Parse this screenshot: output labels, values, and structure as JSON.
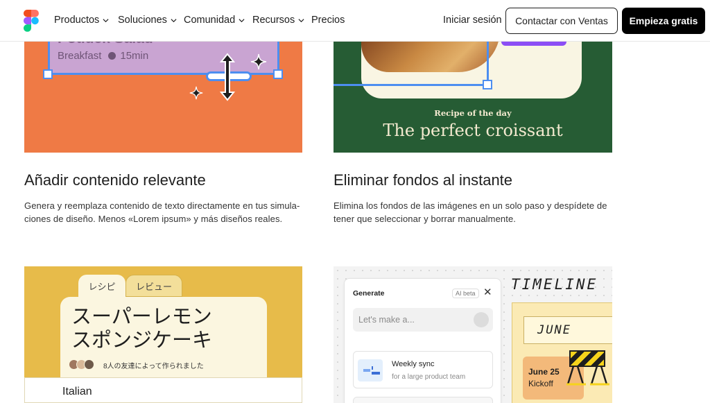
{
  "nav": {
    "items": [
      {
        "label": "Productos",
        "has_dropdown": true
      },
      {
        "label": "Soluciones",
        "has_dropdown": true
      },
      {
        "label": "Comunidad",
        "has_dropdown": true
      },
      {
        "label": "Recursos",
        "has_dropdown": true
      },
      {
        "label": "Precios",
        "has_dropdown": false
      }
    ],
    "login": "Iniciar sesión",
    "contact": "Contactar con Ventas",
    "start": "Empieza gratis"
  },
  "cards": [
    {
      "title": "Añadir contenido relevante",
      "desc_line1": "Genera y reemplaza contenido de texto directamente en tus simula-",
      "desc_line2": "ciones de diseño. Menos «Lorem ipsum» y más diseños reales.",
      "image": {
        "heading": "Potluck Salad",
        "meta": "Breakfast",
        "time": "15min"
      },
      "bg": "#ef7a45"
    },
    {
      "title": "Eliminar fondos al instante",
      "desc_line1": "Elimina los fondos de las imágenes en un solo paso y despídete de",
      "desc_line2": "tener que seleccionar y borrar manualmente.",
      "image": {
        "kicker": "Recipe of the day",
        "headline": "The perfect croissant"
      },
      "bg": "#265c34"
    },
    {
      "image": {
        "tab1": "レシピ",
        "tab2": "レビュー",
        "line1": "スーパーレモン",
        "line2": "スポンジケーキ",
        "friends": "8人の友達によって作られました",
        "label": "Italian"
      },
      "bg": "#e7bb4a"
    },
    {
      "image": {
        "panel_title": "Generate",
        "badge": "AI beta",
        "close": "✕",
        "placeholder": "Let's make a...",
        "row_title": "Weekly sync",
        "row_sub": "for a large product team",
        "timeline": "TIMELINE",
        "month": "JUNE",
        "event_date": "June 25",
        "event_name": "Kickoff"
      },
      "bg": "#f3f3f3"
    }
  ],
  "colors": {
    "selection": "#4d8ef0",
    "accent_purple": "#8c4ef5",
    "text": "#1e1e1e"
  }
}
